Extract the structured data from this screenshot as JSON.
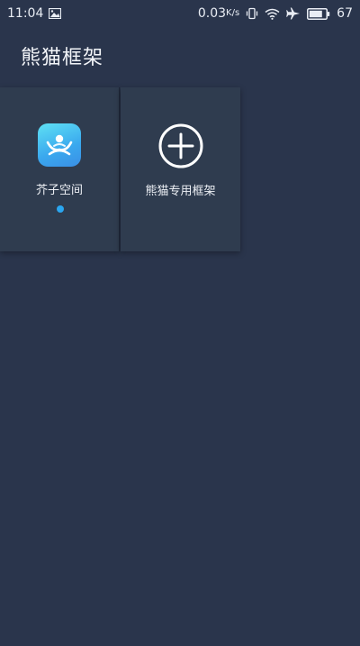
{
  "status_bar": {
    "time": "11:04",
    "net_speed": "0.03",
    "net_speed_unit": "K/s",
    "battery_level": "67",
    "icons": [
      "image-icon",
      "vibrate-icon",
      "wifi-icon",
      "airplane-icon",
      "battery-icon"
    ]
  },
  "header": {
    "title": "熊猫框架"
  },
  "cards": [
    {
      "label": "芥子空间",
      "icon": "mustard-space-app-icon",
      "active": true,
      "accent_color": "#2aa6f0"
    },
    {
      "label": "熊猫专用框架",
      "icon": "add-circle-icon"
    }
  ],
  "colors": {
    "background": "#2a354c",
    "card": "#2f3c4f",
    "accent": "#2aa6f0"
  }
}
